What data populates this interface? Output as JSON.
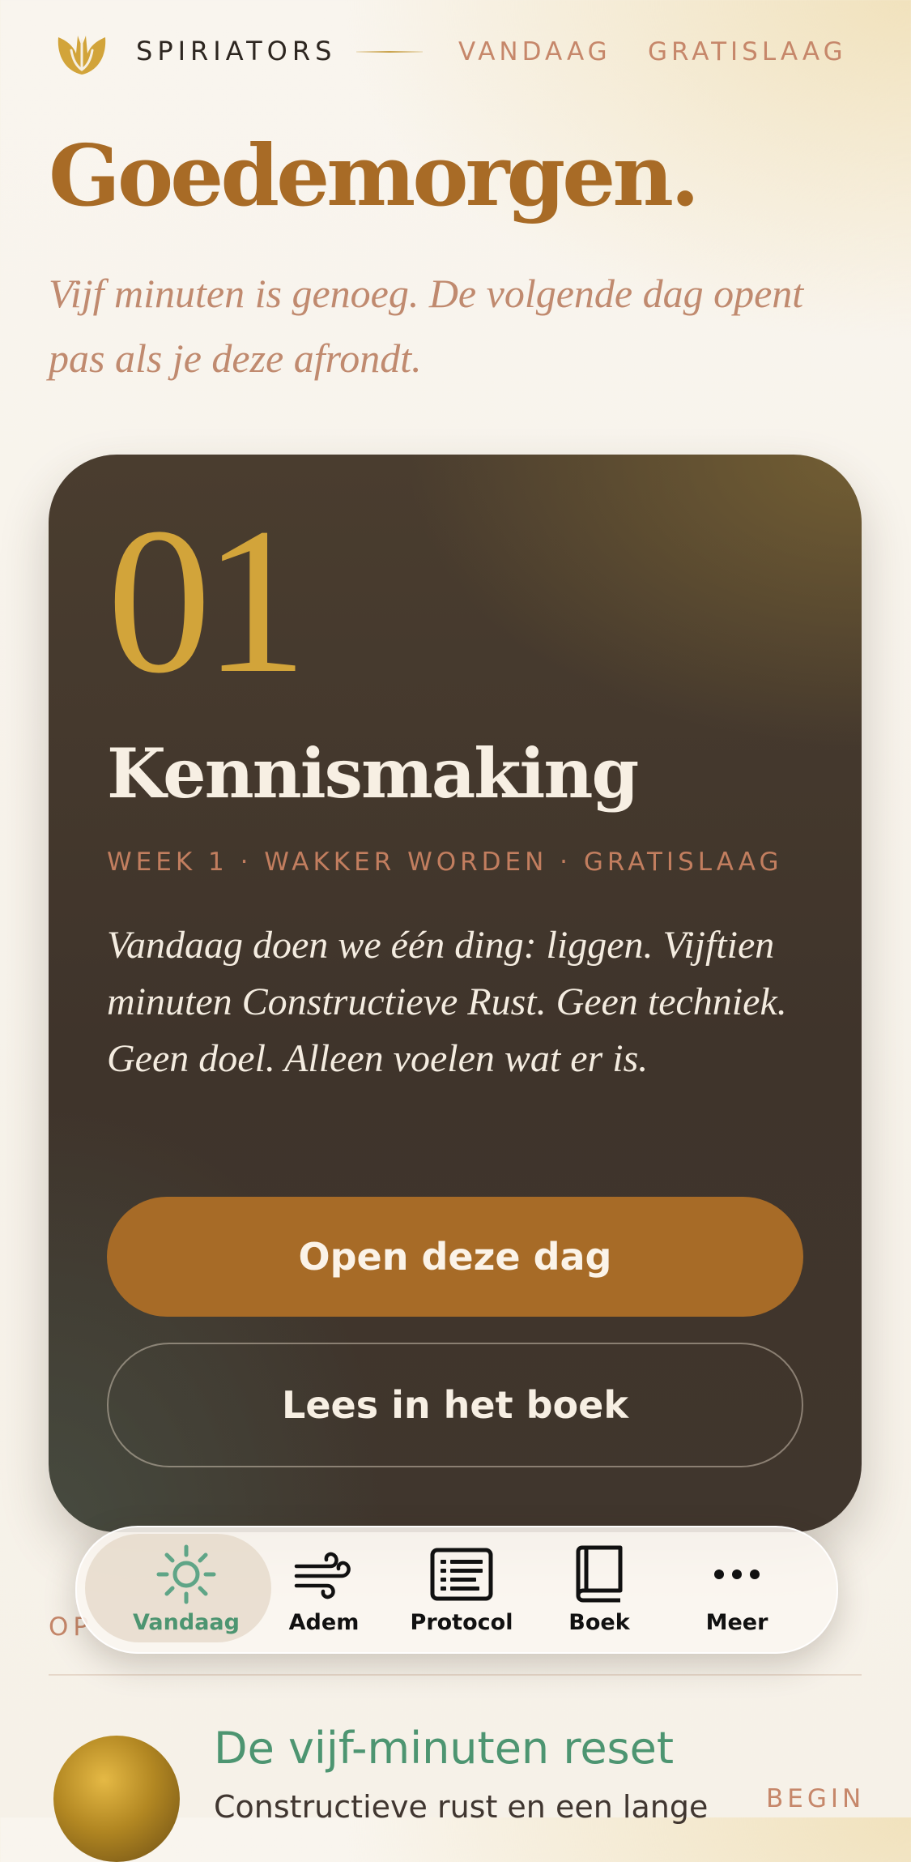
{
  "header": {
    "brand": "SPIRIATORS",
    "nav": [
      "VANDAAG",
      "GRATISLAAG"
    ]
  },
  "greeting": {
    "title": "Goedemorgen.",
    "subtitle": "Vijf minuten is genoeg. De volgende dag opent pas als je deze afrondt."
  },
  "day_card": {
    "number": "01",
    "title": "Kennismaking",
    "meta": "WEEK 1 · WAKKER WORDEN · GRATISLAAG",
    "description": "Vandaag doen we één ding: liggen. Vijftien minuten Constructieve Rust. Geen techniek. Geen doel. Alleen voelen wat er is.",
    "primary_button": "Open deze dag",
    "secondary_button": "Lees in het boek"
  },
  "section": {
    "label": "OP"
  },
  "reset": {
    "title": "De vijf-minuten reset",
    "subtitle": "Constructieve rust en een lange",
    "action": "BEGIN"
  },
  "tabbar": {
    "tabs": [
      {
        "label": "Vandaag",
        "icon": "sun-icon",
        "active": true
      },
      {
        "label": "Adem",
        "icon": "wind-icon",
        "active": false
      },
      {
        "label": "Protocol",
        "icon": "document-icon",
        "active": false
      },
      {
        "label": "Boek",
        "icon": "book-icon",
        "active": false
      },
      {
        "label": "Meer",
        "icon": "more-icon",
        "active": false
      }
    ]
  },
  "colors": {
    "accent_brown": "#a86b26",
    "gold": "#d2a43a",
    "terracotta": "#c6876a",
    "green": "#4d9571",
    "card_bg": "#433629"
  }
}
